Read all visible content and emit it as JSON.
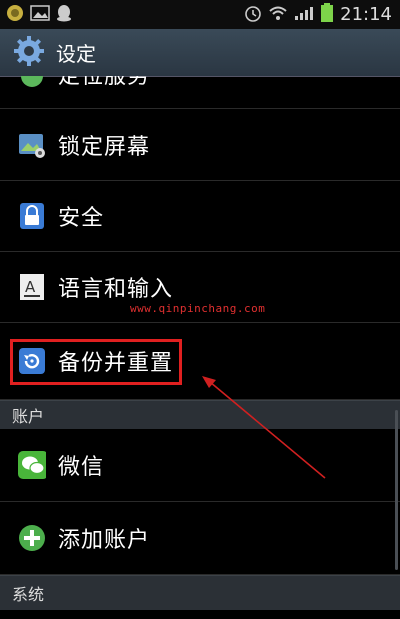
{
  "status_bar": {
    "time": "21:14",
    "icons": [
      "notification-icon",
      "gallery-icon",
      "qq-icon",
      "alarm-icon",
      "wifi-icon",
      "signal-icon",
      "battery-icon"
    ]
  },
  "title_bar": {
    "title": "设定",
    "icon": "gear-icon"
  },
  "settings": {
    "partial_item": "定位服务",
    "items": [
      {
        "label": "锁定屏幕",
        "icon": "lock-screen-icon"
      },
      {
        "label": "安全",
        "icon": "padlock-icon"
      },
      {
        "label": "语言和输入",
        "icon": "language-icon"
      },
      {
        "label": "备份并重置",
        "icon": "backup-reset-icon"
      }
    ]
  },
  "sections": {
    "accounts": {
      "title": "账户",
      "items": [
        {
          "label": "微信",
          "icon": "wechat-icon"
        },
        {
          "label": "添加账户",
          "icon": "add-account-icon"
        }
      ]
    },
    "system": {
      "title": "系统"
    }
  },
  "watermark": "www.qinpinchang.com",
  "colors": {
    "highlight": "#e02020",
    "section_bg": "#2b3036",
    "titlebar_bg": "#2f3b47"
  }
}
